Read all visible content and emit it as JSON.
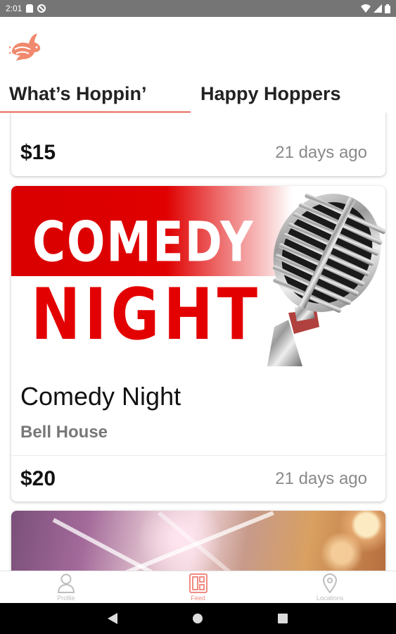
{
  "status_bar": {
    "time": "2:01",
    "left_icons": [
      "sd-card-icon",
      "no-sync-icon"
    ],
    "right_icons": [
      "wifi-icon",
      "signal-icon",
      "battery-icon"
    ]
  },
  "header": {
    "logo_icon": "rabbit-logo-icon",
    "tabs": [
      {
        "label": "What’s Hoppin’",
        "active": true
      },
      {
        "label": "Happy Hoppers",
        "active": false
      }
    ],
    "accent_color": "#e8705f"
  },
  "feed": {
    "items": [
      {
        "price": "$15",
        "time_ago": "21 days ago"
      },
      {
        "image_text_line1": "COMEDY",
        "image_text_line2": "NIGHT",
        "title": "Comedy Night",
        "venue": "Bell House",
        "price": "$20",
        "time_ago": "21 days ago"
      },
      {
        "image": "concert-lights-photo"
      }
    ]
  },
  "bottom_nav": {
    "items": [
      {
        "label": "Profile",
        "icon": "person-icon",
        "active": false
      },
      {
        "label": "Feed",
        "icon": "feed-icon",
        "active": true
      },
      {
        "label": "Locations",
        "icon": "location-pin-icon",
        "active": false
      }
    ],
    "active_color": "#f28b82",
    "inactive_color": "#bdbdbd"
  },
  "system_nav": {
    "buttons": [
      "back-icon",
      "home-icon",
      "recents-icon"
    ]
  }
}
